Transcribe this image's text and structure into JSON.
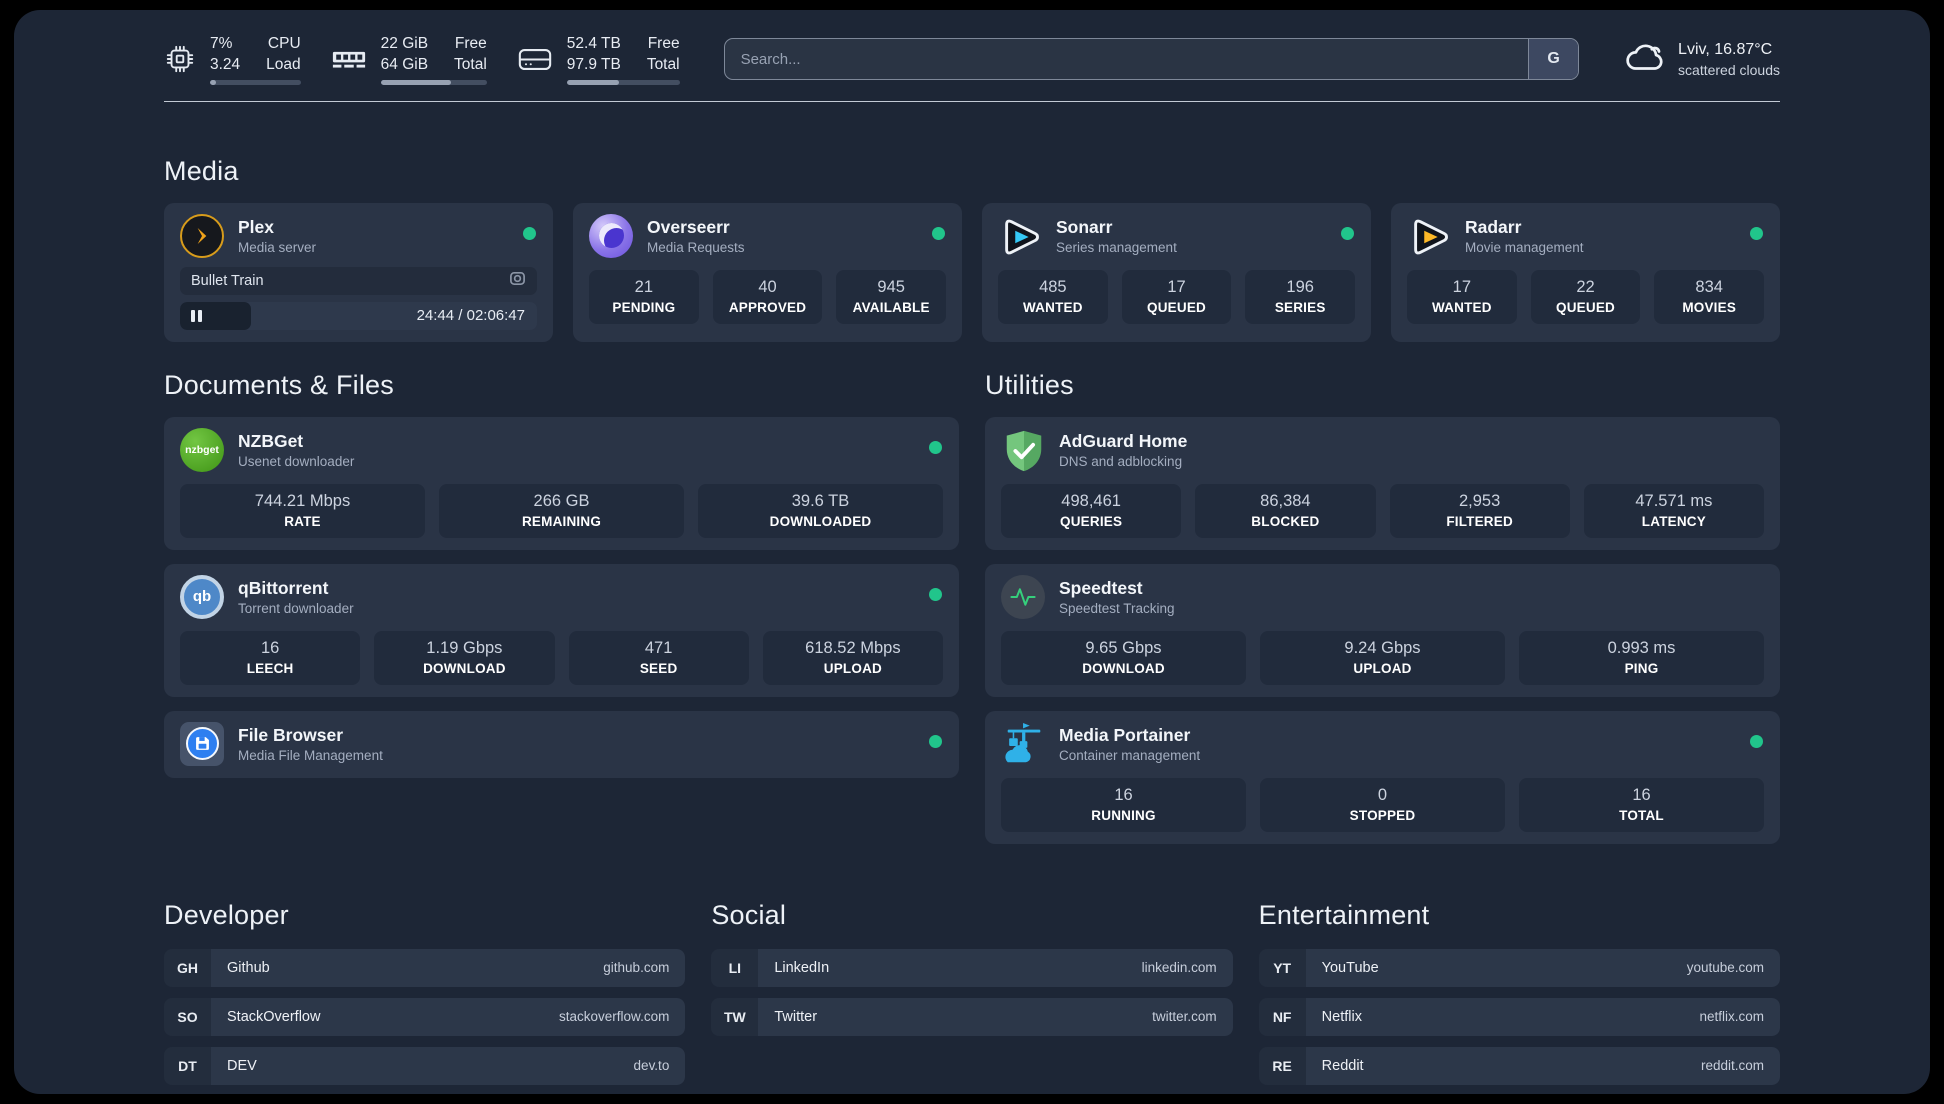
{
  "topbar": {
    "cpu": {
      "value_line1": "7%",
      "value_line2": "3.24",
      "label_line1": "CPU",
      "label_line2": "Load",
      "progress": "7%"
    },
    "memory": {
      "value_line1": "22 GiB",
      "value_line2": "64 GiB",
      "label_line1": "Free",
      "label_line2": "Total",
      "progress": "66%"
    },
    "storage": {
      "value_line1": "52.4 TB",
      "value_line2": "97.9 TB",
      "label_line1": "Free",
      "label_line2": "Total",
      "progress": "46%"
    },
    "search": {
      "placeholder": "Search...",
      "engine_button": "G"
    },
    "weather": {
      "location": "Lviv, 16.87°C",
      "condition": "scattered clouds"
    }
  },
  "media": {
    "title": "Media",
    "plex": {
      "name": "Plex",
      "desc": "Media server",
      "now_playing": "Bullet Train",
      "time": "24:44 / 02:06:47",
      "progress": "20%"
    },
    "overseerr": {
      "name": "Overseerr",
      "desc": "Media Requests",
      "stats": [
        {
          "value": "21",
          "label": "PENDING"
        },
        {
          "value": "40",
          "label": "APPROVED"
        },
        {
          "value": "945",
          "label": "AVAILABLE"
        }
      ]
    },
    "sonarr": {
      "name": "Sonarr",
      "desc": "Series management",
      "stats": [
        {
          "value": "485",
          "label": "WANTED"
        },
        {
          "value": "17",
          "label": "QUEUED"
        },
        {
          "value": "196",
          "label": "SERIES"
        }
      ]
    },
    "radarr": {
      "name": "Radarr",
      "desc": "Movie management",
      "stats": [
        {
          "value": "17",
          "label": "WANTED"
        },
        {
          "value": "22",
          "label": "QUEUED"
        },
        {
          "value": "834",
          "label": "MOVIES"
        }
      ]
    }
  },
  "docs": {
    "title": "Documents & Files",
    "nzbget": {
      "name": "NZBGet",
      "desc": "Usenet downloader",
      "icon_text": "nzbget",
      "stats": [
        {
          "value": "744.21 Mbps",
          "label": "RATE"
        },
        {
          "value": "266 GB",
          "label": "REMAINING"
        },
        {
          "value": "39.6 TB",
          "label": "DOWNLOADED"
        }
      ]
    },
    "qbittorrent": {
      "name": "qBittorrent",
      "desc": "Torrent downloader",
      "icon_text": "qb",
      "stats": [
        {
          "value": "16",
          "label": "LEECH"
        },
        {
          "value": "1.19 Gbps",
          "label": "DOWNLOAD"
        },
        {
          "value": "471",
          "label": "SEED"
        },
        {
          "value": "618.52 Mbps",
          "label": "UPLOAD"
        }
      ]
    },
    "filebrowser": {
      "name": "File Browser",
      "desc": "Media File Management"
    }
  },
  "util": {
    "title": "Utilities",
    "adguard": {
      "name": "AdGuard Home",
      "desc": "DNS and adblocking",
      "stats": [
        {
          "value": "498,461",
          "label": "QUERIES"
        },
        {
          "value": "86,384",
          "label": "BLOCKED"
        },
        {
          "value": "2,953",
          "label": "FILTERED"
        },
        {
          "value": "47.571 ms",
          "label": "LATENCY"
        }
      ]
    },
    "speedtest": {
      "name": "Speedtest",
      "desc": "Speedtest Tracking",
      "stats": [
        {
          "value": "9.65 Gbps",
          "label": "DOWNLOAD"
        },
        {
          "value": "9.24 Gbps",
          "label": "UPLOAD"
        },
        {
          "value": "0.993 ms",
          "label": "PING"
        }
      ]
    },
    "portainer": {
      "name": "Media Portainer",
      "desc": "Container management",
      "stats": [
        {
          "value": "16",
          "label": "RUNNING"
        },
        {
          "value": "0",
          "label": "STOPPED"
        },
        {
          "value": "16",
          "label": "TOTAL"
        }
      ]
    }
  },
  "links": {
    "developer": {
      "title": "Developer",
      "items": [
        {
          "abbr": "GH",
          "name": "Github",
          "url": "github.com"
        },
        {
          "abbr": "SO",
          "name": "StackOverflow",
          "url": "stackoverflow.com"
        },
        {
          "abbr": "DT",
          "name": "DEV",
          "url": "dev.to"
        }
      ]
    },
    "social": {
      "title": "Social",
      "items": [
        {
          "abbr": "LI",
          "name": "LinkedIn",
          "url": "linkedin.com"
        },
        {
          "abbr": "TW",
          "name": "Twitter",
          "url": "twitter.com"
        }
      ]
    },
    "entertainment": {
      "title": "Entertainment",
      "items": [
        {
          "abbr": "YT",
          "name": "YouTube",
          "url": "youtube.com"
        },
        {
          "abbr": "NF",
          "name": "Netflix",
          "url": "netflix.com"
        },
        {
          "abbr": "RE",
          "name": "Reddit",
          "url": "reddit.com"
        }
      ]
    }
  },
  "colors": {
    "background": "#1d2636",
    "card": "#2a3446",
    "tile": "#212b3c",
    "status_online": "#21c58b",
    "plex": "#e5a00d",
    "overseerr": "#6a51dd",
    "sonarr": "#35c8f5",
    "radarr": "#fdb827",
    "nzbget": "#54a932",
    "qbittorrent": "#4e88c8",
    "filebrowser": "#2e7ff0",
    "adguard": "#68ba72",
    "speedtest": "#35d07c",
    "portainer": "#2fb1e8"
  }
}
